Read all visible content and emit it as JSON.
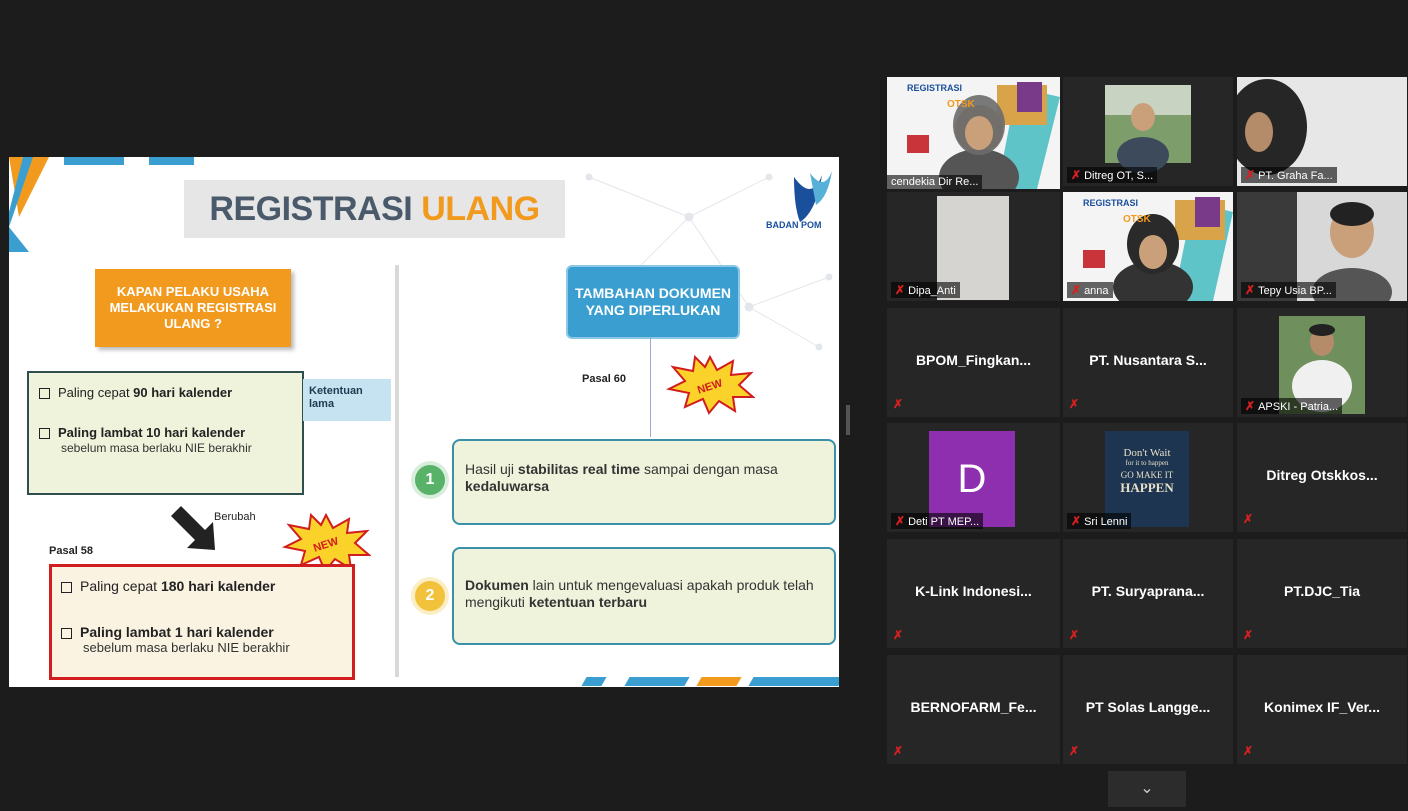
{
  "slide": {
    "title_a": "REGISTRASI",
    "title_b": "ULANG",
    "logo_text": "BADAN POM",
    "left_question": "KAPAN PELAKU USAHA MELAKUKAN REGISTRASI ULANG ?",
    "old_item1_prefix": "Paling cepat ",
    "old_item1_bold": "90 hari kalender",
    "old_item2_bold": "Paling lambat 10 hari kalender",
    "old_item2_sub": "sebelum masa berlaku NIE berakhir",
    "ketentuan_lama": "Ketentuan lama",
    "berubah": "Berubah",
    "new_badge": "NEW",
    "pasal58": "Pasal 58",
    "new_item1_prefix": "Paling cepat ",
    "new_item1_bold": "180 hari kalender",
    "new_item2_bold": "Paling lambat 1 hari kalender",
    "new_item2_sub": "sebelum masa berlaku NIE berakhir",
    "right_question": "TAMBAHAN DOKUMEN YANG DIPERLUKAN",
    "pasal60": "Pasal 60",
    "doc1_number": "1",
    "doc1_a": "Hasil uji ",
    "doc1_b": "stabilitas real time",
    "doc1_c": " sampai dengan masa ",
    "doc1_d": "kedaluwarsa",
    "doc2_number": "2",
    "doc2_a": "Dokumen",
    "doc2_b": " lain untuk mengevaluasi apakah produk telah mengikuti ",
    "doc2_c": "ketentuan terbaru"
  },
  "participants": [
    {
      "name": "cendekia Dir Re...",
      "type": "video",
      "active": true
    },
    {
      "name": "Ditreg OT, S...",
      "type": "video"
    },
    {
      "name": "PT. Graha Fa...",
      "type": "video"
    },
    {
      "name": "Dipa_Anti",
      "type": "video"
    },
    {
      "name": "anna",
      "type": "video"
    },
    {
      "name": "Tepy Usia BP...",
      "type": "video"
    },
    {
      "name": "BPOM_Fingkan...",
      "type": "name"
    },
    {
      "name": "PT. Nusantara S...",
      "type": "name"
    },
    {
      "name": "APSKI - Patria...",
      "type": "video"
    },
    {
      "name": "Deti PT MEP...",
      "type": "avatar",
      "initial": "D"
    },
    {
      "name": "Sri Lenni",
      "type": "video"
    },
    {
      "name": "Ditreg  Otskkos...",
      "type": "name"
    },
    {
      "name": "K-Link  Indonesi...",
      "type": "name"
    },
    {
      "name": "PT.  Suryaprana...",
      "type": "name"
    },
    {
      "name": "PT.DJC_Tia",
      "type": "name"
    },
    {
      "name": "BERNOFARM_Fe...",
      "type": "name"
    },
    {
      "name": "PT Solas  Langge...",
      "type": "name"
    },
    {
      "name": "Konimex  IF_Ver...",
      "type": "name"
    }
  ],
  "thumb_texts": {
    "registrasi": "REGISTRASI",
    "otsk": "OTSK",
    "poster_line1": "Don't Wait",
    "poster_line2": "for it to happen",
    "poster_line3": "GO MAKE IT",
    "poster_line4": "HAPPEN"
  },
  "colors": {
    "accent_orange": "#f29a1e",
    "accent_blue": "#3a9fd0",
    "active_speaker": "#b7e04c",
    "muted_mic": "#d82020",
    "avatar_purple": "#8e2fb0"
  },
  "icons": {
    "mic": "mic-muted-icon",
    "more": "chevron-down-icon"
  }
}
